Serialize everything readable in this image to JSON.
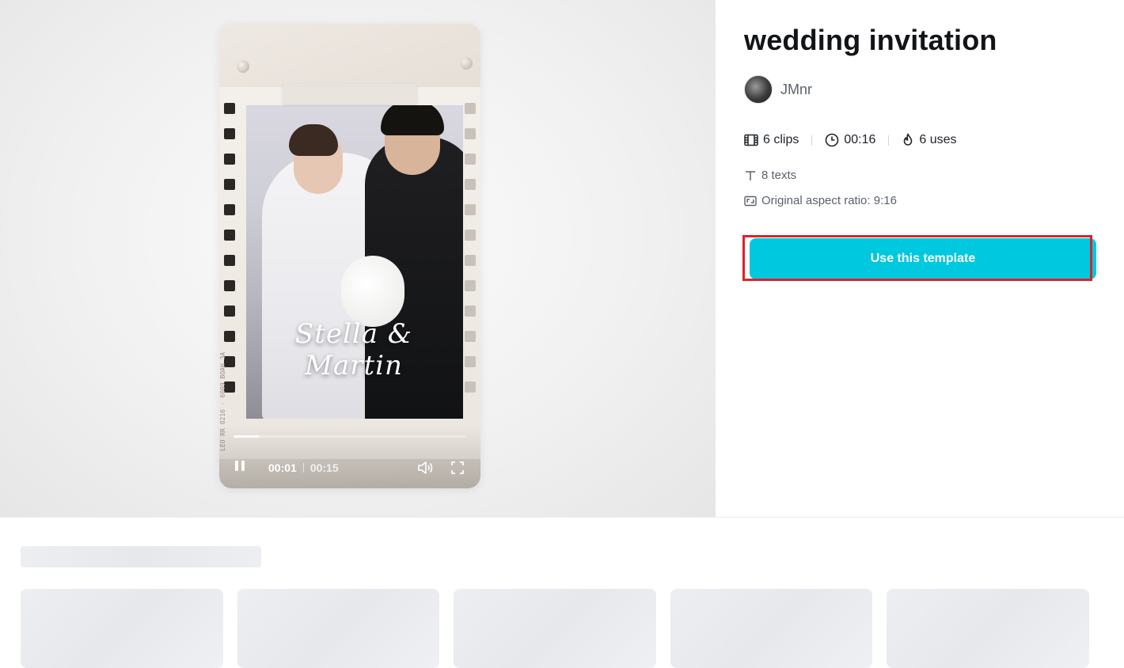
{
  "video": {
    "overlay_text": "Stella & Martin",
    "side_text": "LEO RR 0216 · 6009 BOAH 3A",
    "current_time": "00:01",
    "total_time": "00:15",
    "progress_fraction": 0.11
  },
  "template": {
    "title": "wedding invitation",
    "author": "JMnr",
    "clips": "6 clips",
    "duration": "00:16",
    "uses": "6 uses",
    "texts": "8 texts",
    "aspect_ratio": "Original aspect ratio: 9:16",
    "cta_label": "Use this template"
  },
  "colors": {
    "accent": "#00c8df",
    "highlight_border": "#e02126"
  },
  "icons": {
    "clips": "film-icon",
    "duration": "clock-icon",
    "uses": "flame-icon",
    "texts": "text-icon",
    "aspect": "aspect-ratio-icon",
    "pause": "pause-icon",
    "volume": "volume-icon",
    "fullscreen": "fullscreen-icon"
  }
}
